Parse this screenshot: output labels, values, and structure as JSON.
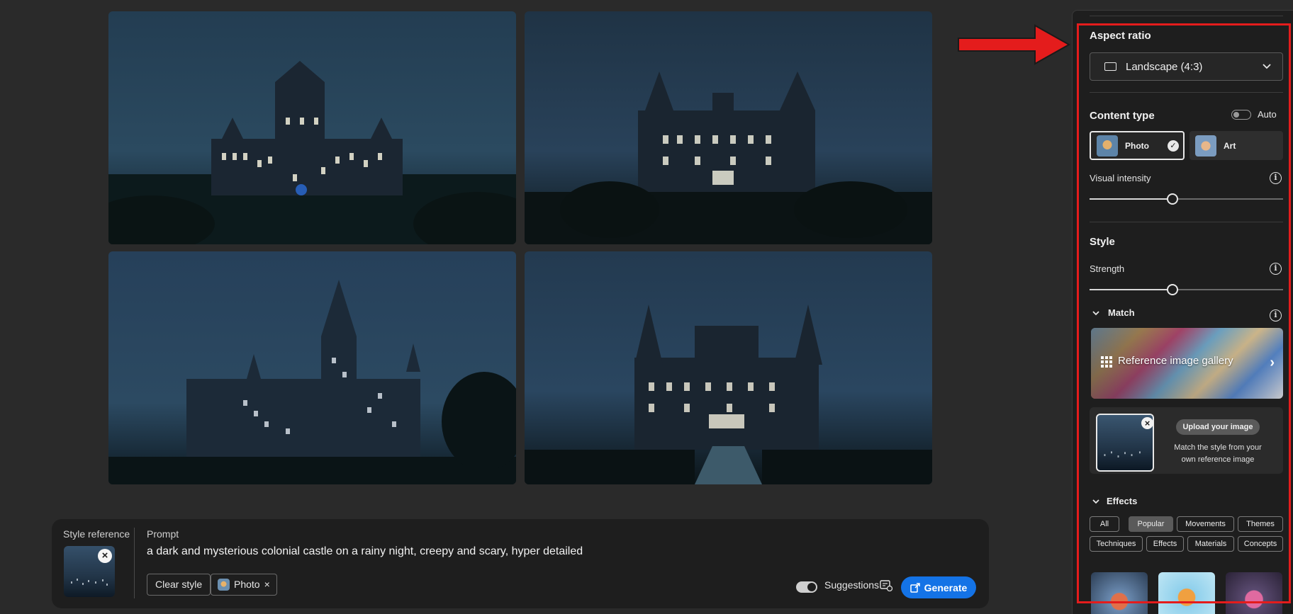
{
  "prompt_bar": {
    "style_reference_label": "Style reference",
    "prompt_label": "Prompt",
    "prompt_text": "a dark and mysterious colonial castle on a rainy night, creepy and scary, hyper detailed",
    "clear_style_label": "Clear style",
    "chip_label": "Photo",
    "chip_remove": "×",
    "suggestions_label": "Suggestions",
    "generate_label": "Generate",
    "close_glyph": "×"
  },
  "panel": {
    "aspect_ratio": {
      "title": "Aspect ratio",
      "selected": "Landscape (4:3)"
    },
    "content_type": {
      "title": "Content type",
      "auto_label": "Auto",
      "options": [
        {
          "label": "Photo",
          "selected": true
        },
        {
          "label": "Art",
          "selected": false
        }
      ],
      "visual_intensity_label": "Visual intensity",
      "visual_intensity_value": 0.43
    },
    "style": {
      "title": "Style",
      "strength_label": "Strength",
      "strength_value": 0.43,
      "match_label": "Match",
      "gallery_label": "Reference image gallery",
      "upload_button": "Upload your image",
      "upload_description": "Match the style from your own reference image"
    },
    "effects": {
      "title": "Effects",
      "row1": [
        "All",
        "Popular",
        "Movements",
        "Themes"
      ],
      "row2": [
        "Techniques",
        "Effects",
        "Materials",
        "Concepts"
      ],
      "active": "Popular"
    },
    "info_glyph": "i"
  },
  "colors": {
    "accent": "#1473e6",
    "highlight": "#e41c1c",
    "panel_bg": "#1e1e1e",
    "page_bg": "#2a2a2a"
  }
}
